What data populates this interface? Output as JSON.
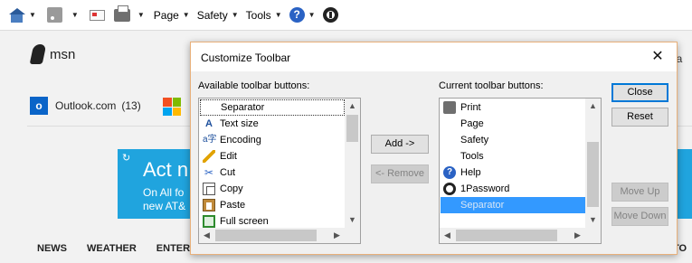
{
  "command_bar": {
    "items": [
      {
        "name": "home",
        "icon": "home-icon"
      },
      {
        "name": "feeds",
        "icon": "feed-icon"
      },
      {
        "name": "read-mail",
        "icon": "mail-icon"
      },
      {
        "name": "print",
        "icon": "print-icon"
      }
    ],
    "page_label": "Page",
    "safety_label": "Safety",
    "tools_label": "Tools",
    "help_icon": "help-icon",
    "help_glyph": "?",
    "onepassword_icon": "1password-icon"
  },
  "background_page": {
    "logo_text": "msn",
    "outlook_label": "Outlook.com",
    "outlook_count": "(13)",
    "outlook_icon_letter": "o",
    "truncated_right_text": "cla",
    "ad_headline": "Act n",
    "ad_line1": "On All fo",
    "ad_line2": "new AT&",
    "nav_items": [
      "NEWS",
      "WEATHER",
      "ENTERTA"
    ],
    "nav_right": "UTO",
    "colors": {
      "ad_blue": "#20a4de",
      "outlook_blue": "#0a64c8"
    }
  },
  "dialog": {
    "title": "Customize Toolbar",
    "close_glyph": "✕",
    "available_label": "Available toolbar buttons:",
    "current_label": "Current toolbar buttons:",
    "available_items": [
      {
        "label": "Separator",
        "icon": "none",
        "state": "focused"
      },
      {
        "label": "Text size",
        "icon": "text-size-icon"
      },
      {
        "label": "Encoding",
        "icon": "encoding-icon"
      },
      {
        "label": "Edit",
        "icon": "edit-icon"
      },
      {
        "label": "Cut",
        "icon": "cut-icon"
      },
      {
        "label": "Copy",
        "icon": "copy-icon"
      },
      {
        "label": "Paste",
        "icon": "paste-icon"
      },
      {
        "label": "Full screen",
        "icon": "full-screen-icon"
      }
    ],
    "current_items": [
      {
        "label": "Print",
        "icon": "print-icon"
      },
      {
        "label": "Page",
        "icon": "none"
      },
      {
        "label": "Safety",
        "icon": "none"
      },
      {
        "label": "Tools",
        "icon": "none"
      },
      {
        "label": "Help",
        "icon": "help-icon"
      },
      {
        "label": "1Password",
        "icon": "1password-icon"
      },
      {
        "label": "Separator",
        "icon": "none",
        "state": "selected"
      }
    ],
    "buttons": {
      "add": "Add ->",
      "remove": "<- Remove",
      "close": "Close",
      "reset": "Reset",
      "move_up": "Move Up",
      "move_down": "Move Down"
    },
    "button_states": {
      "add": "enabled",
      "remove": "disabled",
      "close": "default",
      "reset": "enabled",
      "move_up": "disabled",
      "move_down": "disabled"
    },
    "colors": {
      "selection": "#3399ff",
      "accent_border": "#e8b07a",
      "default_button": "#0078d7"
    }
  }
}
